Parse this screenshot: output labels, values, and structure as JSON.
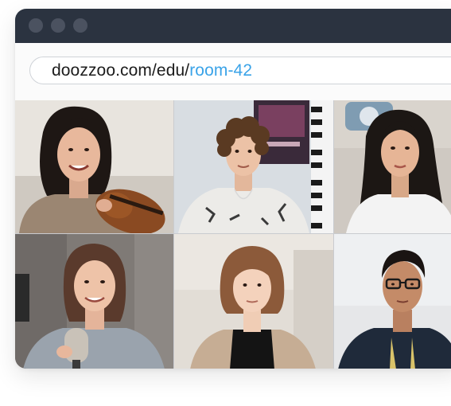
{
  "window": {
    "controls": [
      "close-dot",
      "minimize-dot",
      "maximize-dot"
    ]
  },
  "address_bar": {
    "url_base": "doozzoo.com/edu/",
    "url_room": "room-42",
    "base_color": "#1c1c1c",
    "room_color": "#3aa3e8"
  },
  "video_grid": {
    "participants": [
      {
        "description": "woman-with-violin"
      },
      {
        "description": "young-man-curly-hair-piano"
      },
      {
        "description": "young-woman-long-dark-hair"
      },
      {
        "description": "woman-with-microphone"
      },
      {
        "description": "girl-bob-haircut"
      },
      {
        "description": "man-with-glasses"
      }
    ]
  },
  "colors": {
    "titlebar": "#2b3340",
    "accent": "#3aa3e8"
  }
}
